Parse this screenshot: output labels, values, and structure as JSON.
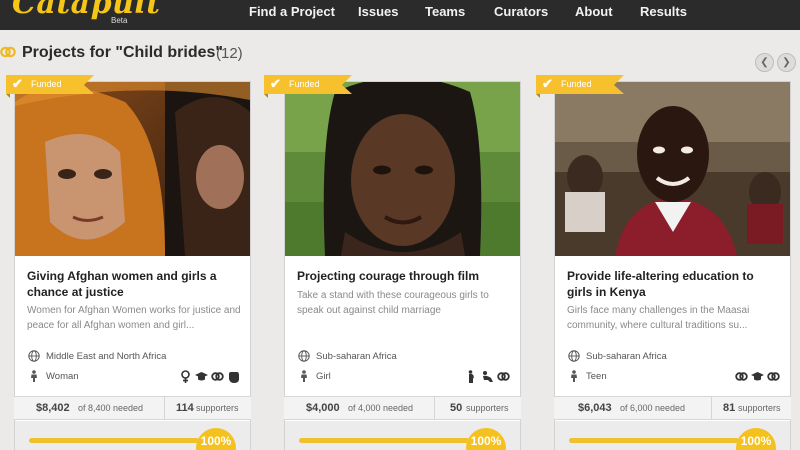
{
  "app": {
    "logo": "Catapult",
    "badge": "Beta"
  },
  "nav": [
    {
      "label": "Find a Project"
    },
    {
      "label": "Issues"
    },
    {
      "label": "Teams"
    },
    {
      "label": "Curators"
    },
    {
      "label": "About"
    },
    {
      "label": "Results"
    }
  ],
  "page": {
    "title": "Projects for \"Child brides\"",
    "count": "(12)"
  },
  "carousel": {
    "prev_icon": "chevron-left-icon",
    "next_icon": "chevron-right-icon"
  },
  "colors": {
    "accent": "#f6c12c",
    "nav_bg": "#2b2b2b",
    "page_bg": "#eceae8"
  },
  "projects": [
    {
      "status": "Funded",
      "title": "Giving Afghan women and girls a chance at justice",
      "description": "Women for Afghan Women works for justice and peace for all Afghan women and girl...",
      "region": "Middle East and North Africa",
      "audience": "Woman",
      "theme_icons": [
        "female-symbol-icon",
        "graduation-cap-icon",
        "link-icon",
        "raised-fist-icon"
      ],
      "raised": "$8,402",
      "needed": "of 8,400 needed",
      "supporters_count": "114",
      "supporters_label": "supporters",
      "progress_percent": 100,
      "progress_label": "100%"
    },
    {
      "status": "Funded",
      "title": "Projecting courage through film",
      "description": "Take a stand with these courageous girls to speak out against child marriage",
      "region": "Sub-saharan Africa",
      "audience": "Girl",
      "theme_icons": [
        "pregnant-woman-icon",
        "baby-icon",
        "link-icon"
      ],
      "raised": "$4,000",
      "needed": "of 4,000 needed",
      "supporters_count": "50",
      "supporters_label": "supporters",
      "progress_percent": 100,
      "progress_label": "100%"
    },
    {
      "status": "Funded",
      "title": "Provide life-altering education to girls in Kenya",
      "description": "Girls face many challenges in the Maasai community, where cultural traditions su...",
      "region": "Sub-saharan Africa",
      "audience": "Teen",
      "theme_icons": [
        "link-icon",
        "graduation-cap-icon",
        "link-icon"
      ],
      "raised": "$6,043",
      "needed": "of 6,000 needed",
      "supporters_count": "81",
      "supporters_label": "supporters",
      "progress_percent": 100,
      "progress_label": "100%"
    }
  ]
}
